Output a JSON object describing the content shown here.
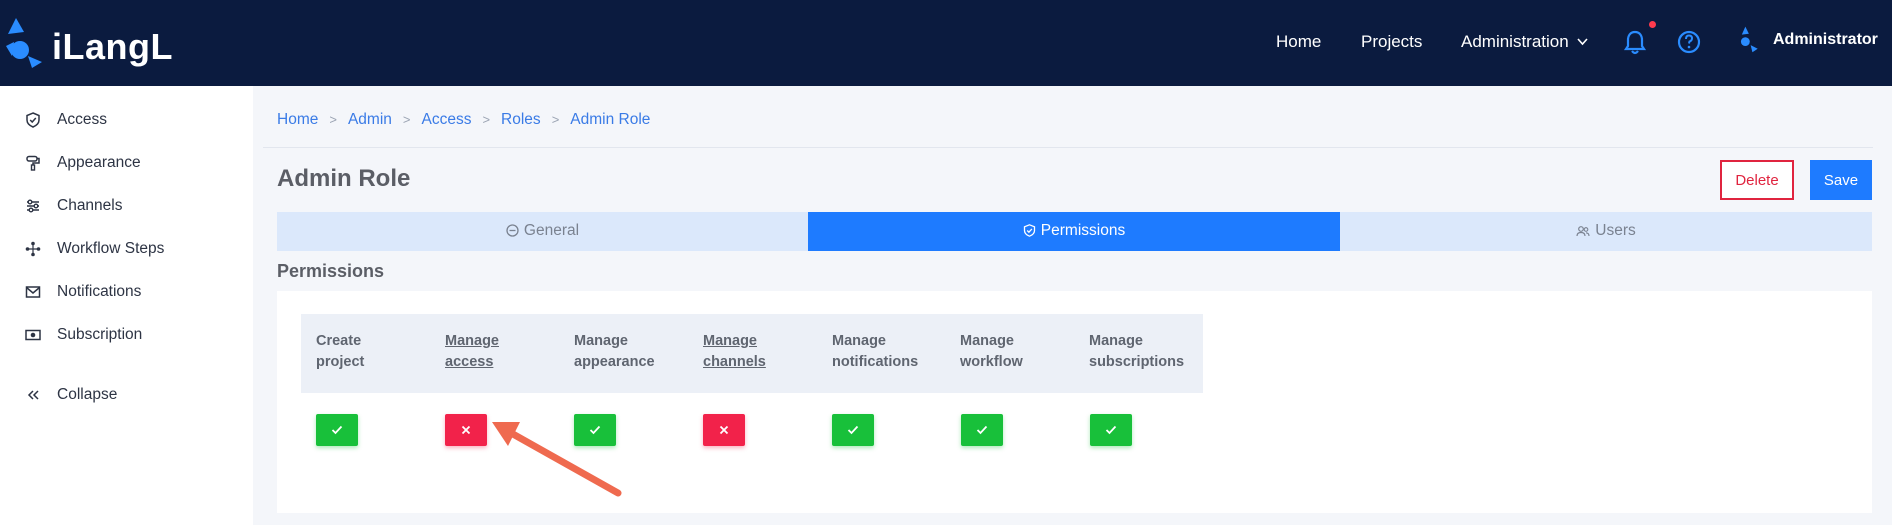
{
  "brand": {
    "name": "iLangL"
  },
  "nav": {
    "home": "Home",
    "projects": "Projects",
    "administration": "Administration",
    "user": "Administrator"
  },
  "sidebar": {
    "items": [
      {
        "label": "Access",
        "icon": "shield-check-icon"
      },
      {
        "label": "Appearance",
        "icon": "paint-roller-icon"
      },
      {
        "label": "Channels",
        "icon": "sliders-icon"
      },
      {
        "label": "Workflow Steps",
        "icon": "workflow-icon"
      },
      {
        "label": "Notifications",
        "icon": "envelope-icon"
      },
      {
        "label": "Subscription",
        "icon": "money-icon"
      },
      {
        "label": "Collapse",
        "icon": "double-chevron-left-icon"
      }
    ]
  },
  "breadcrumb": [
    "Home",
    "Admin",
    "Access",
    "Roles",
    "Admin Role"
  ],
  "page": {
    "title": "Admin Role",
    "delete_label": "Delete",
    "save_label": "Save"
  },
  "tabs": [
    {
      "label": "General",
      "active": false
    },
    {
      "label": "Permissions",
      "active": true
    },
    {
      "label": "Users",
      "active": false
    }
  ],
  "permissions": {
    "title": "Permissions",
    "columns": [
      {
        "line1": "Create",
        "line2": "project",
        "link": false,
        "granted": true
      },
      {
        "line1": "Manage",
        "line2": "access",
        "link": true,
        "granted": false
      },
      {
        "line1": "Manage",
        "line2": "appearance",
        "link": false,
        "granted": true
      },
      {
        "line1": "Manage",
        "line2": "channels",
        "link": true,
        "granted": false
      },
      {
        "line1": "Manage",
        "line2": "notifications",
        "link": false,
        "granted": true
      },
      {
        "line1": "Manage",
        "line2": "workflow",
        "link": false,
        "granted": true
      },
      {
        "line1": "Manage",
        "line2": "subscriptions",
        "link": false,
        "granted": true
      }
    ]
  },
  "colors": {
    "navbar": "#0b1b3f",
    "accent": "#1e7bff",
    "granted": "#18c03a",
    "denied": "#f2224a",
    "annotation_arrow": "#ef6a4f"
  }
}
